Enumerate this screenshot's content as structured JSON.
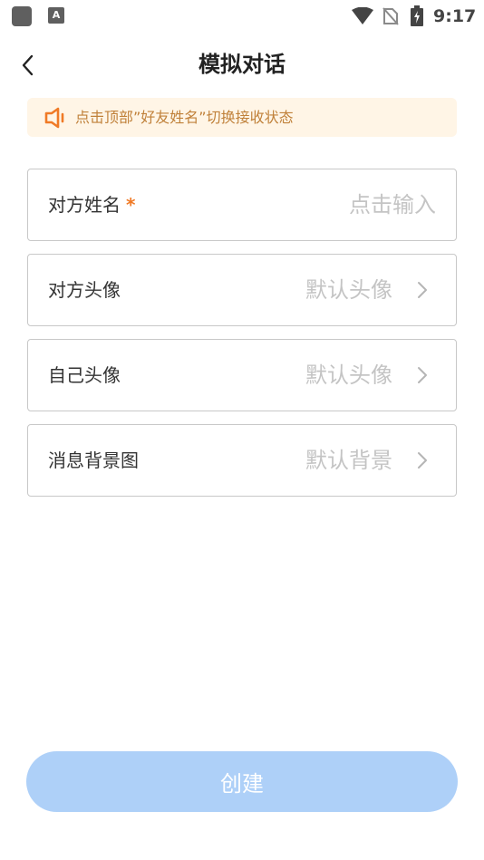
{
  "status_bar": {
    "time": "9:17",
    "a_badge": "A",
    "icons": [
      "app-icon",
      "a-notification-icon",
      "wifi-icon",
      "no-sim-icon",
      "battery-charging-icon"
    ]
  },
  "header": {
    "title": "模拟对话",
    "back_icon": "chevron-left-icon"
  },
  "notice": {
    "text": "点击顶部”好友姓名”切换接收状态",
    "icon": "speaker-icon",
    "color": "#c0813a",
    "background": "#fff5e6"
  },
  "form": {
    "friend_name": {
      "label": "对方姓名",
      "required_mark": "*",
      "value": "",
      "placeholder": "点击输入"
    },
    "friend_avatar": {
      "label": "对方头像",
      "value": "默认头像"
    },
    "self_avatar": {
      "label": "自己头像",
      "value": "默认头像"
    },
    "message_background": {
      "label": "消息背景图",
      "value": "默认背景"
    }
  },
  "create_button": {
    "label": "创建",
    "color": "#aed0f8"
  },
  "colors": {
    "accent_star": "#f07a26",
    "placeholder": "#c4c4c4",
    "border": "#c8c8c8"
  }
}
